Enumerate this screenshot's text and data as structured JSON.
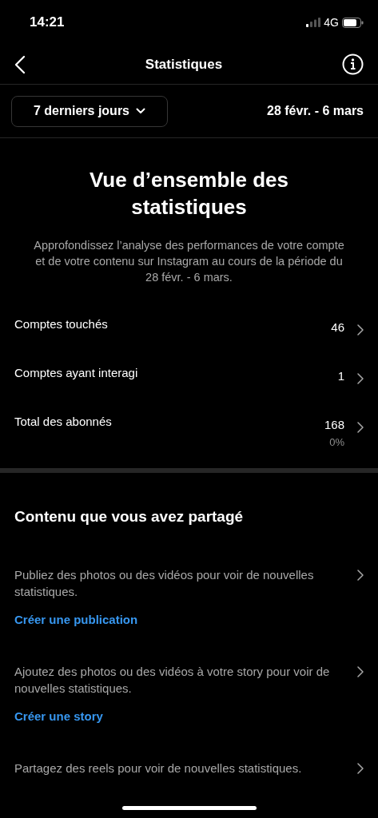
{
  "status_bar": {
    "time": "14:21",
    "network": "4G"
  },
  "header": {
    "title": "Statistiques"
  },
  "filter": {
    "period": "7 derniers jours",
    "range": "28 févr. - 6 mars"
  },
  "overview": {
    "title": "Vue d’ensemble des statistiques",
    "description": "Approfondissez l’analyse des performances de votre compte et de votre contenu sur Instagram au cours de la période du 28 févr. - 6 mars."
  },
  "metrics": [
    {
      "label": "Comptes touchés",
      "value": "46"
    },
    {
      "label": "Comptes ayant interagi",
      "value": "1"
    },
    {
      "label": "Total des abonnés",
      "value": "168",
      "change": "0%"
    }
  ],
  "content": {
    "title": "Contenu que vous avez partagé",
    "items": [
      {
        "text": "Publiez des photos ou des vidéos pour voir de nouvelles statistiques.",
        "link": "Créer une publication"
      },
      {
        "text": "Ajoutez des photos ou des vidéos à votre story pour voir de nouvelles statistiques.",
        "link": "Créer une story"
      },
      {
        "text": "Partagez des reels pour voir de nouvelles statistiques."
      }
    ]
  }
}
